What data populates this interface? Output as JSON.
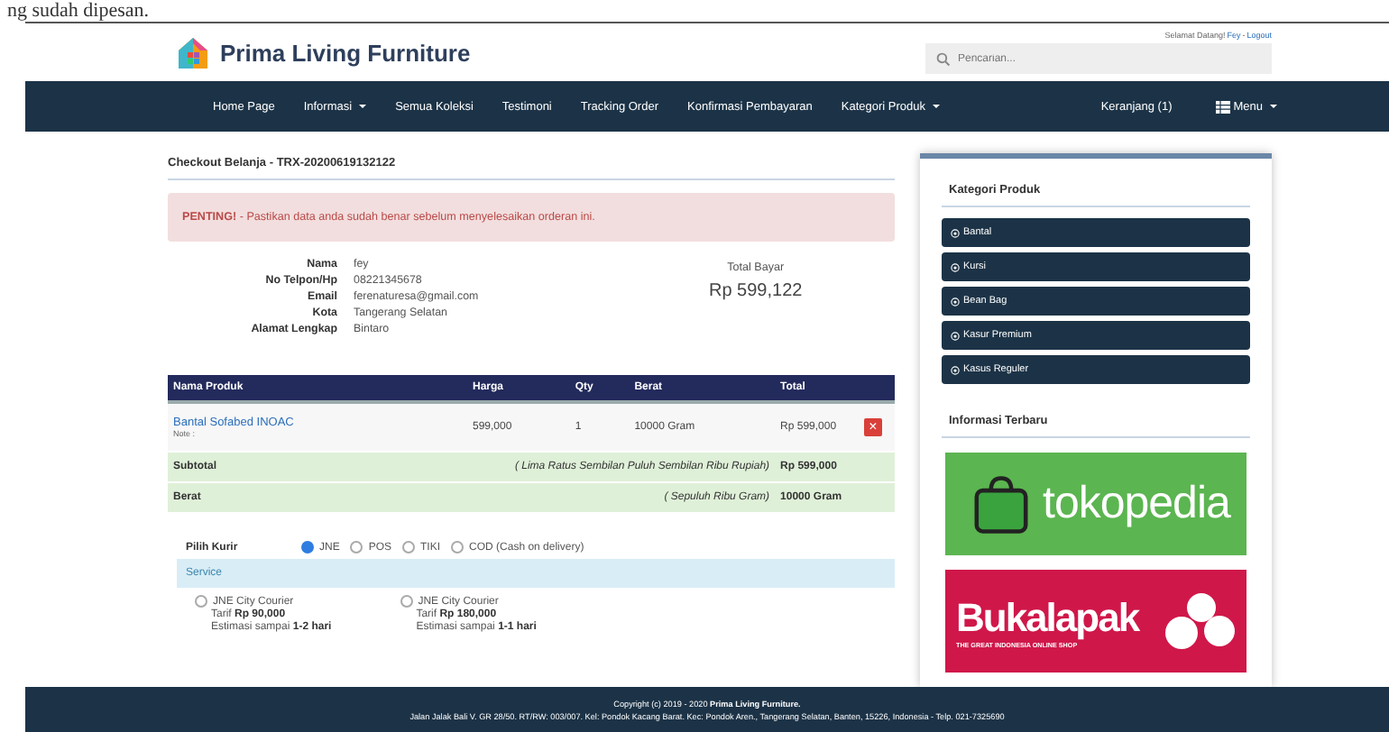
{
  "caption": "ng sudah dipesan.",
  "header": {
    "brand": "Prima Living Furniture",
    "greeting": "Selamat Datang!",
    "user": "Fey",
    "separator": "-",
    "logout": "Logout",
    "search": {
      "placeholder": "Pencarian..."
    }
  },
  "nav": [
    {
      "label": "Home Page",
      "dropdown": false
    },
    {
      "label": "Informasi",
      "dropdown": true
    },
    {
      "label": "Semua Koleksi",
      "dropdown": false
    },
    {
      "label": "Testimoni",
      "dropdown": false
    },
    {
      "label": "Tracking Order",
      "dropdown": false
    },
    {
      "label": "Konfirmasi Pembayaran",
      "dropdown": false
    },
    {
      "label": "Kategori Produk",
      "dropdown": true
    }
  ],
  "nav_right": [
    {
      "label": "Keranjang (1)",
      "dropdown": false,
      "icon": false
    },
    {
      "label": "Menu",
      "dropdown": true,
      "icon": true
    }
  ],
  "checkout": {
    "title": "Checkout Belanja - TRX-20200619132122",
    "alert": {
      "strong": "PENTING!",
      "text": " - Pastikan data anda sudah benar sebelum menyelesaikan orderan ini."
    },
    "fields": [
      {
        "label": "Nama",
        "value": "fey"
      },
      {
        "label": "No Telpon/Hp",
        "value": "08221345678"
      },
      {
        "label": "Email",
        "value": "ferenaturesa@gmail.com"
      },
      {
        "label": "Kota",
        "value": "Tangerang Selatan"
      },
      {
        "label": "Alamat Lengkap",
        "value": "Bintaro"
      }
    ],
    "total_label": "Total Bayar",
    "total": "Rp 599,122"
  },
  "table": {
    "columns": [
      "Nama Produk",
      "Harga",
      "Qty",
      "Berat",
      "Total"
    ],
    "rows": [
      {
        "product": "Bantal Sofabed INOAC",
        "note": "Note :",
        "price": "599,000",
        "qty": "1",
        "weight": "10000 Gram",
        "total": "Rp 599,000",
        "delete": "×"
      }
    ],
    "summary": [
      {
        "label": "Subtotal",
        "words": "( Lima Ratus Sembilan Puluh Sembilan Ribu Rupiah)",
        "value": "Rp 599,000"
      },
      {
        "label": "Berat",
        "words": "( Sepuluh Ribu Gram)",
        "value": "10000 Gram"
      }
    ]
  },
  "courier": {
    "label": "Pilih Kurir",
    "options": [
      {
        "label": "JNE",
        "selected": true
      },
      {
        "label": "POS",
        "selected": false
      },
      {
        "label": "TIKI",
        "selected": false
      },
      {
        "label": "COD (Cash on delivery)",
        "selected": false
      }
    ],
    "service_label": "Service",
    "services": [
      {
        "name": "JNE City Courier",
        "tariff_label": "Tarif",
        "tariff": "Rp 90,000",
        "eta_label": "Estimasi sampai",
        "eta": "1-2 hari",
        "selected": false
      },
      {
        "name": "JNE City Courier",
        "tariff_label": "Tarif",
        "tariff": "Rp 180,000",
        "eta_label": "Estimasi sampai",
        "eta": "1-1 hari",
        "selected": false
      }
    ]
  },
  "sidebar": {
    "categories_title": "Kategori Produk",
    "categories": [
      "Bantal",
      "Kursi",
      "Bean Bag",
      "Kasur Premium",
      "Kasus Reguler"
    ],
    "news_title": "Informasi Terbaru",
    "banners": [
      {
        "kind": "tokopedia",
        "text": "tokopedia"
      },
      {
        "kind": "bukalapak",
        "text": "Bukalapak",
        "tagline": "THE GREAT INDONESIA ONLINE SHOP"
      }
    ]
  },
  "footer": {
    "copyright": "Copyright (c) 2019 - 2020 **Prima Living Furniture.**",
    "address": "Jalan Jalak Bali V. GR 28/50. RT/RW: 003/007. Kel: Pondok Kacang Barat. Kec: Pondok Aren., Tangerang Selatan, Banten, 15226, Indonesia - Telp. 021-7325690"
  }
}
